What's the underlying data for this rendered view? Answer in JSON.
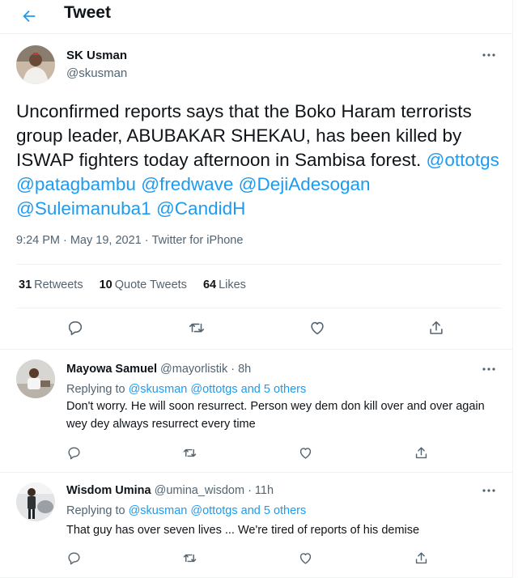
{
  "header": {
    "title": "Tweet"
  },
  "main_tweet": {
    "name": "SK Usman",
    "handle": "@skusman",
    "text_before": "Unconfirmed reports says that the Boko Haram terrorists group leader, ABUBAKAR SHEKAU, has been killed by ISWAP fighters today afternoon in Sambisa forest.",
    "mentions": [
      "@ottotgs",
      "@patagbambu",
      "@fredwave",
      "@DejiAdesogan",
      "@Suleimanuba1",
      "@CandidH"
    ],
    "time": "9:24 PM",
    "date": "May 19, 2021",
    "source": "Twitter for iPhone",
    "stats": {
      "retweets_count": "31",
      "retweets_label": "Retweets",
      "quotes_count": "10",
      "quotes_label": "Quote Tweets",
      "likes_count": "64",
      "likes_label": "Likes"
    }
  },
  "replies": [
    {
      "name": "Mayowa Samuel",
      "handle": "@mayorlistik",
      "age": "· 8h",
      "replying_prefix": "Replying to",
      "replying_to": "@skusman @ottotgs and 5 others",
      "text": "Don't worry. He will soon resurrect. Person wey dem don kill over and over again wey dey always resurrect every time"
    },
    {
      "name": "Wisdom Umina",
      "handle": "@umina_wisdom",
      "age": "· 11h",
      "replying_prefix": "Replying to",
      "replying_to": "@skusman @ottotgs and 5 others",
      "text": "That guy has over seven lives ...  We're tired of reports of his demise"
    }
  ],
  "icons": {
    "back": "arrow-left-icon",
    "more": "more-horizontal-icon",
    "reply": "comment-icon",
    "retweet": "retweet-icon",
    "like": "heart-icon",
    "share": "share-icon"
  },
  "colors": {
    "accent": "#1d9bf0",
    "text": "#0f1419",
    "secondary": "#536471",
    "border": "#eff3f4"
  }
}
